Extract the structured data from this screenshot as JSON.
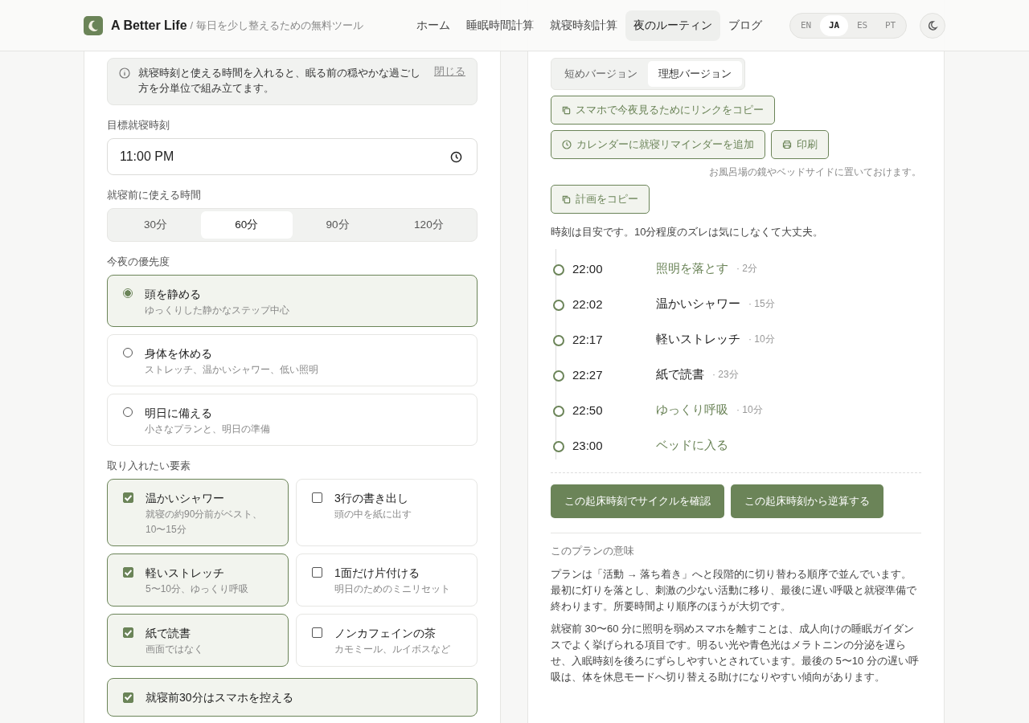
{
  "header": {
    "brand": "A Better Life",
    "tagline": "/ 毎日を少し整えるための無料ツール",
    "nav": [
      {
        "label": "ホーム",
        "selected": false
      },
      {
        "label": "睡眠時間計算",
        "selected": false
      },
      {
        "label": "就寝時刻計算",
        "selected": false
      },
      {
        "label": "夜のルーティン",
        "selected": true
      },
      {
        "label": "ブログ",
        "selected": false
      }
    ],
    "languages": [
      {
        "label": "EN",
        "selected": false
      },
      {
        "label": "JA",
        "selected": true
      },
      {
        "label": "ES",
        "selected": false
      },
      {
        "label": "PT",
        "selected": false
      }
    ]
  },
  "form": {
    "notice": {
      "text": "就寝時刻と使える時間を入れると、眠る前の穏やかな過ごし方を分単位で組み立てます。",
      "close": "閉じる"
    },
    "bedtime": {
      "label": "目標就寝時刻",
      "value": "11:00 PM"
    },
    "duration": {
      "label": "就寝前に使える時間",
      "options": [
        {
          "label": "30分",
          "selected": false
        },
        {
          "label": "60分",
          "selected": true
        },
        {
          "label": "90分",
          "selected": false
        },
        {
          "label": "120分",
          "selected": false
        }
      ]
    },
    "priority": {
      "label": "今夜の優先度",
      "options": [
        {
          "title": "頭を静める",
          "subtitle": "ゆっくりした静かなステップ中心",
          "selected": true
        },
        {
          "title": "身体を休める",
          "subtitle": "ストレッチ、温かいシャワー、低い照明",
          "selected": false
        },
        {
          "title": "明日に備える",
          "subtitle": "小さなプランと、明日の準備",
          "selected": false
        }
      ]
    },
    "elements": {
      "label": "取り入れたい要素",
      "items": [
        {
          "title": "温かいシャワー",
          "subtitle": "就寝の約90分前がベスト、10〜15分",
          "checked": true
        },
        {
          "title": "3行の書き出し",
          "subtitle": "頭の中を紙に出す",
          "checked": false
        },
        {
          "title": "軽いストレッチ",
          "subtitle": "5〜10分、ゆっくり呼吸",
          "checked": true
        },
        {
          "title": "1面だけ片付ける",
          "subtitle": "明日のためのミニリセット",
          "checked": false
        },
        {
          "title": "紙で読書",
          "subtitle": "画面ではなく",
          "checked": true
        },
        {
          "title": "ノンカフェインの茶",
          "subtitle": "カモミール、ルイボスなど",
          "checked": false
        }
      ]
    },
    "phone_rule": {
      "label": "就寝前30分はスマホを控える",
      "checked": true
    }
  },
  "plan": {
    "versions": [
      {
        "label": "短めバージョン",
        "selected": false
      },
      {
        "label": "理想バージョン",
        "selected": true
      }
    ],
    "copy_link": "スマホで今夜見るためにリンクをコピー",
    "calendar": "カレンダーに就寝リマインダーを追加",
    "print": "印刷",
    "print_note": "お風呂場の鏡やベッドサイドに置いておけます。",
    "copy_plan": "計画をコピー",
    "hint": "時刻は目安です。10分程度のズレは気にしなくて大丈夫。",
    "steps": [
      {
        "time": "22:00",
        "activity": "照明を落とす",
        "duration": "· 2分",
        "accent": true
      },
      {
        "time": "22:02",
        "activity": "温かいシャワー",
        "duration": "· 15分",
        "accent": false
      },
      {
        "time": "22:17",
        "activity": "軽いストレッチ",
        "duration": "· 10分",
        "accent": false
      },
      {
        "time": "22:27",
        "activity": "紙で読書",
        "duration": "· 23分",
        "accent": false
      },
      {
        "time": "22:50",
        "activity": "ゆっくり呼吸",
        "duration": "· 10分",
        "accent": true
      },
      {
        "time": "23:00",
        "activity": "ベッドに入る",
        "accent": true
      }
    ],
    "actions": [
      "この起床時刻でサイクルを確認",
      "この起床時刻から逆算する"
    ],
    "explain": {
      "heading": "このプランの意味",
      "paragraphs": [
        "プランは「活動 → 落ち着き」へと段階的に切り替わる順序で並んでいます。最初に灯りを落とし、刺激の少ない活動に移り、最後に遅い呼吸と就寝準備で終わります。所要時間より順序のほうが大切です。",
        "就寝前 30〜60 分に照明を弱めスマホを離すことは、成人向けの睡眠ガイダンスでよく挙げられる項目です。明るい光や青色光はメラトニンの分泌を遅らせ、入眠時刻を後ろにずらしやすいとされています。最後の 5〜10 分の遅い呼吸は、体を休息モードへ切り替える助けになりやすい傾向があります。"
      ]
    }
  }
}
